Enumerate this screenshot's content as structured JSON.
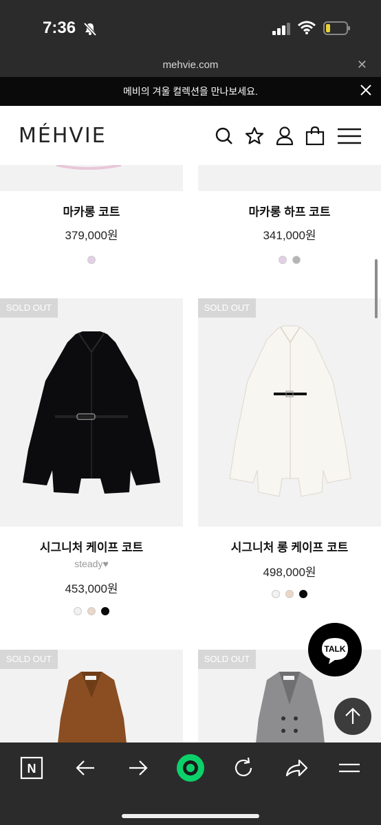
{
  "status_bar": {
    "time": "7:36"
  },
  "browser": {
    "url": "mehvie.com"
  },
  "announcement": {
    "text": "메비의 겨울 컬렉션을 만나보세요."
  },
  "header": {
    "logo": "MÉHVIE"
  },
  "products": [
    {
      "name": "마카롱 코트",
      "sub": "",
      "price": "379,000원",
      "sold_out": false,
      "colors": [
        "#e3cfe6"
      ]
    },
    {
      "name": "마카롱 하프 코트",
      "sub": "",
      "price": "341,000원",
      "sold_out": false,
      "colors": [
        "#e3cfe6",
        "#b4b4b4"
      ]
    },
    {
      "name": "시그니처 케이프 코트",
      "sub": "steady♥",
      "price": "453,000원",
      "sold_out": true,
      "colors": [
        "#f2f2f2",
        "#ead7c8",
        "#0a0a0a"
      ]
    },
    {
      "name": "시그니처 롱 케이프 코트",
      "sub": "",
      "price": "498,000원",
      "sold_out": true,
      "colors": [
        "#f2f2f2",
        "#ead7c8",
        "#0a0a0a"
      ]
    },
    {
      "sold_out": true
    },
    {
      "sold_out": true
    }
  ],
  "badges": {
    "sold_out": "SOLD OUT"
  },
  "floating": {
    "talk": "TALK"
  },
  "bottom_nav": {
    "n_label": "N"
  }
}
